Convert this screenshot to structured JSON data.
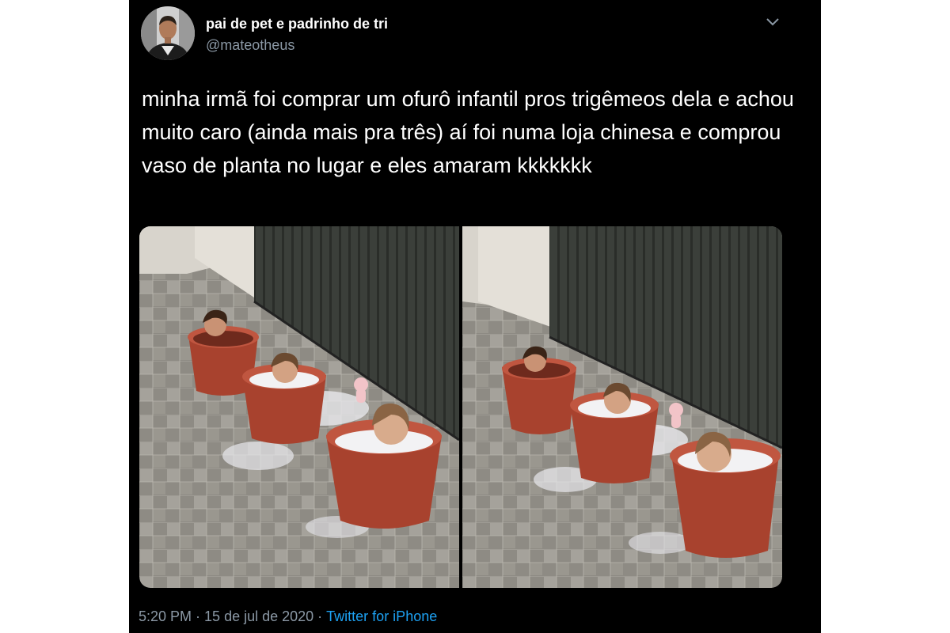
{
  "tweet": {
    "author": {
      "display_name": "pai de pet e padrinho de tri",
      "handle": "@mateotheus",
      "avatar_icon": "profile-photo"
    },
    "menu_icon": "chevron-down-icon",
    "text": "minha irmã foi comprar um ofurô infantil pros trigêmeos dela e achou muito caro (ainda mais pra três) aí foi numa loja chinesa e comprou vaso de planta no lugar e eles amaram kkkkkkk",
    "media": {
      "count": 2,
      "photos": [
        {
          "alt": "photo-1"
        },
        {
          "alt": "photo-2"
        }
      ]
    },
    "meta": {
      "time": "5:20 PM",
      "separator": "·",
      "date": "15 de jul de 2020",
      "source": "Twitter for iPhone"
    }
  },
  "colors": {
    "background": "#000000",
    "text_primary": "#ffffff",
    "text_secondary": "#8b98a5",
    "link": "#1da1f2",
    "bucket": "#a8422e"
  }
}
